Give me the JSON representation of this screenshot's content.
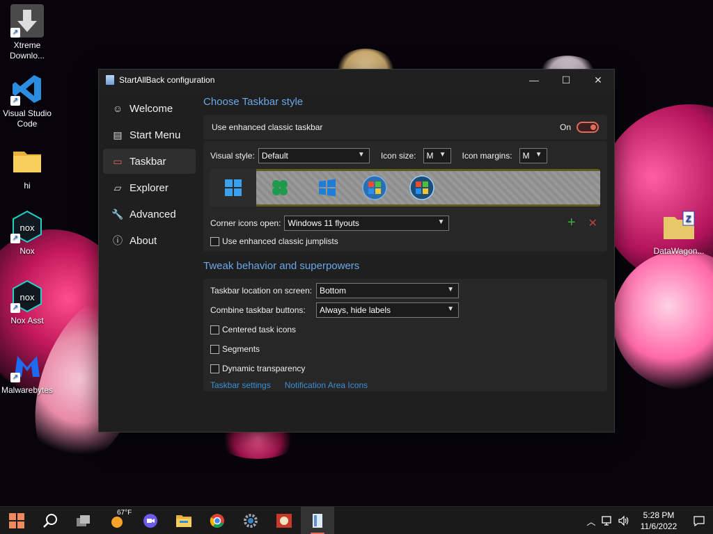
{
  "desktop": {
    "icons": [
      {
        "label": "Xtreme Downlo...",
        "icon": "download-arrow-icon"
      },
      {
        "label": "Visual Studio Code",
        "icon": "vscode-icon"
      },
      {
        "label": "hi",
        "icon": "folder-icon"
      },
      {
        "label": "Nox",
        "icon": "nox-icon"
      },
      {
        "label": "Nox Asst",
        "icon": "nox-asst-icon"
      },
      {
        "label": "Malwarebytes",
        "icon": "malwarebytes-icon"
      },
      {
        "label": "DataWagon...",
        "icon": "zip-folder-icon"
      }
    ]
  },
  "window": {
    "title": "StartAllBack configuration",
    "controls": {
      "minimize": "—",
      "maximize": "☐",
      "close": "✕"
    }
  },
  "sidebar": {
    "items": [
      {
        "label": "Welcome",
        "icon": "smiley-icon",
        "glyph": "☺"
      },
      {
        "label": "Start Menu",
        "icon": "start-menu-icon",
        "glyph": "▤"
      },
      {
        "label": "Taskbar",
        "icon": "taskbar-icon",
        "glyph": "▭"
      },
      {
        "label": "Explorer",
        "icon": "folder-icon",
        "glyph": "▱"
      },
      {
        "label": "Advanced",
        "icon": "wrench-icon",
        "glyph": "🔧"
      },
      {
        "label": "About",
        "icon": "info-icon",
        "glyph": "ⓘ"
      }
    ],
    "active_index": 2
  },
  "taskbar_style": {
    "heading": "Choose Taskbar style",
    "enhanced_label": "Use enhanced classic taskbar",
    "enhanced_state": "On",
    "visual_style_label": "Visual style:",
    "visual_style_value": "Default",
    "icon_size_label": "Icon size:",
    "icon_size_value": "M",
    "icon_margins_label": "Icon margins:",
    "icon_margins_value": "M",
    "corner_icons_label": "Corner icons open:",
    "corner_icons_value": "Windows 11 flyouts",
    "jumplists_label": "Use enhanced classic jumplists",
    "add_glyph": "+",
    "remove_glyph": "✕"
  },
  "tweak": {
    "heading": "Tweak behavior and superpowers",
    "location_label": "Taskbar location on screen:",
    "location_value": "Bottom",
    "combine_label": "Combine taskbar buttons:",
    "combine_value": "Always, hide labels",
    "centered_label": "Centered task icons",
    "segments_label": "Segments",
    "transparency_label": "Dynamic transparency",
    "link_taskbar_settings": "Taskbar settings",
    "link_notification_icons": "Notification Area Icons"
  },
  "taskbar": {
    "weather": "67°F",
    "time": "5:28 PM",
    "date": "11/6/2022"
  },
  "colors": {
    "accent": "#e26b5a",
    "heading_blue": "#6aa8e8",
    "link_blue": "#3d8fd4"
  }
}
